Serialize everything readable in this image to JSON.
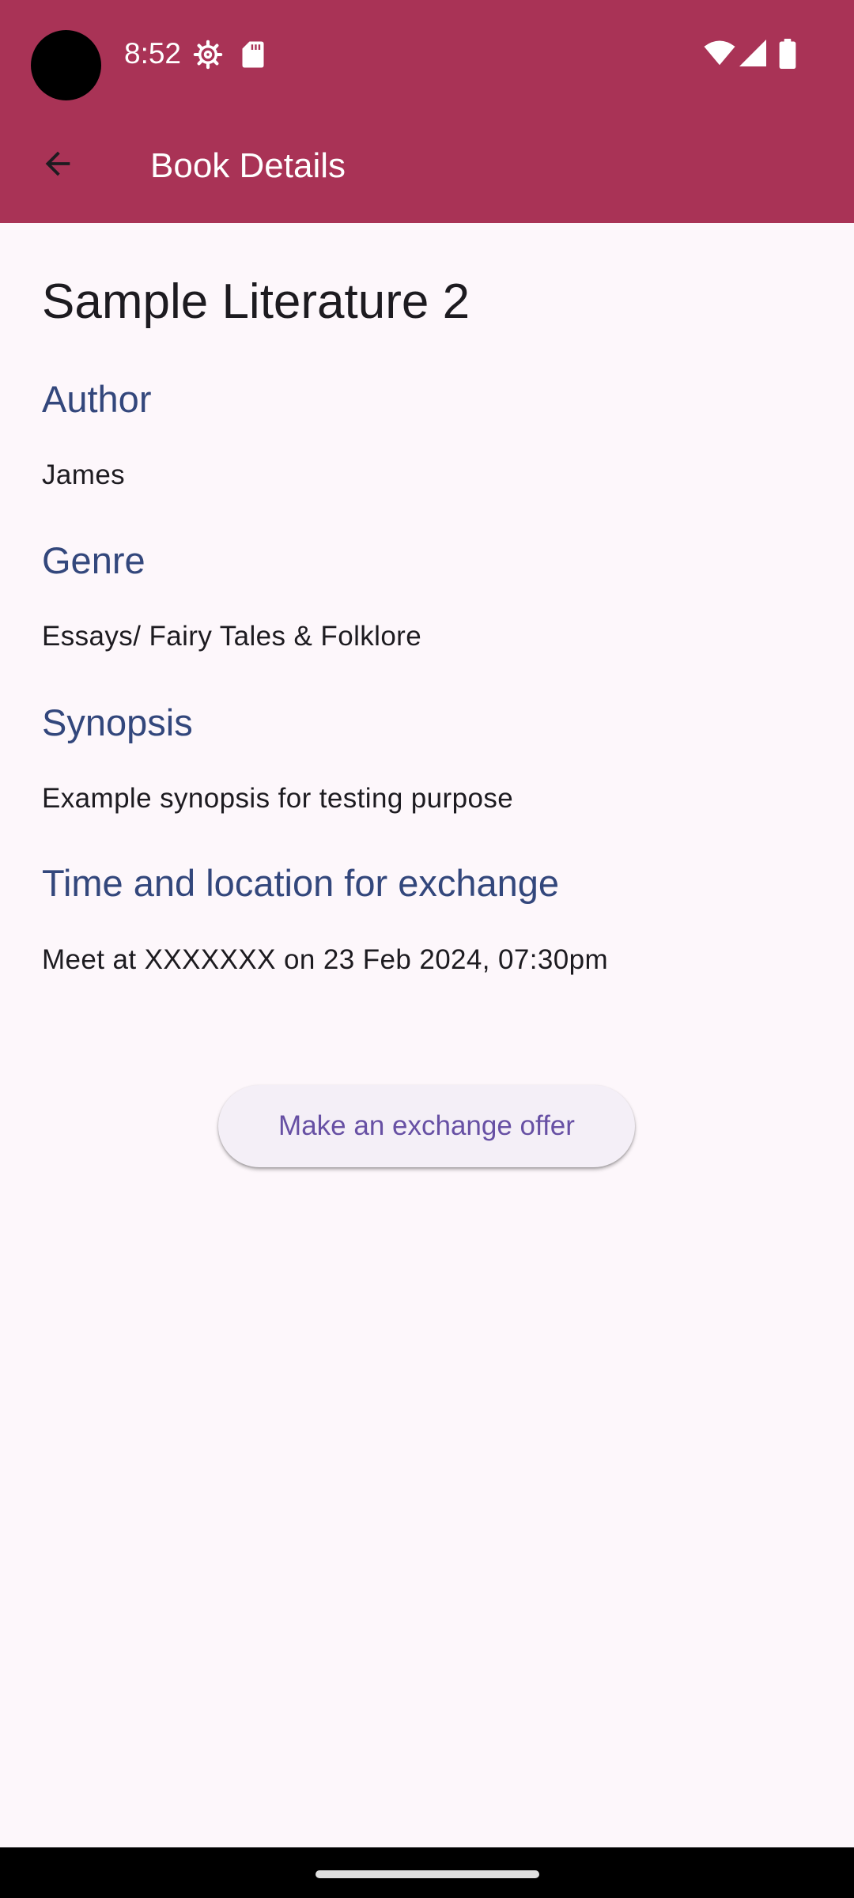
{
  "status_bar": {
    "time": "8:52",
    "icons": [
      "settings-gear-icon",
      "sd-card-icon",
      "wifi-icon",
      "cell-signal-icon",
      "battery-icon"
    ]
  },
  "toolbar": {
    "back_icon": "arrow-back-icon",
    "title": "Book Details"
  },
  "book": {
    "title": "Sample Literature 2",
    "sections": [
      {
        "heading": "Author",
        "text": "James"
      },
      {
        "heading": "Genre",
        "text": "Essays/ Fairy Tales & Folklore"
      },
      {
        "heading": "Synopsis",
        "text": "Example synopsis for testing purpose"
      },
      {
        "heading": "Time and location for exchange",
        "text": "Meet at XXXXXXX on 23 Feb 2024, 07:30pm"
      }
    ]
  },
  "actions": {
    "offer_label": "Make an exchange offer"
  },
  "colors": {
    "app_bar": "#a93356",
    "background": "#fdf7fb",
    "heading": "#33477c",
    "button_text": "#6750a4"
  }
}
